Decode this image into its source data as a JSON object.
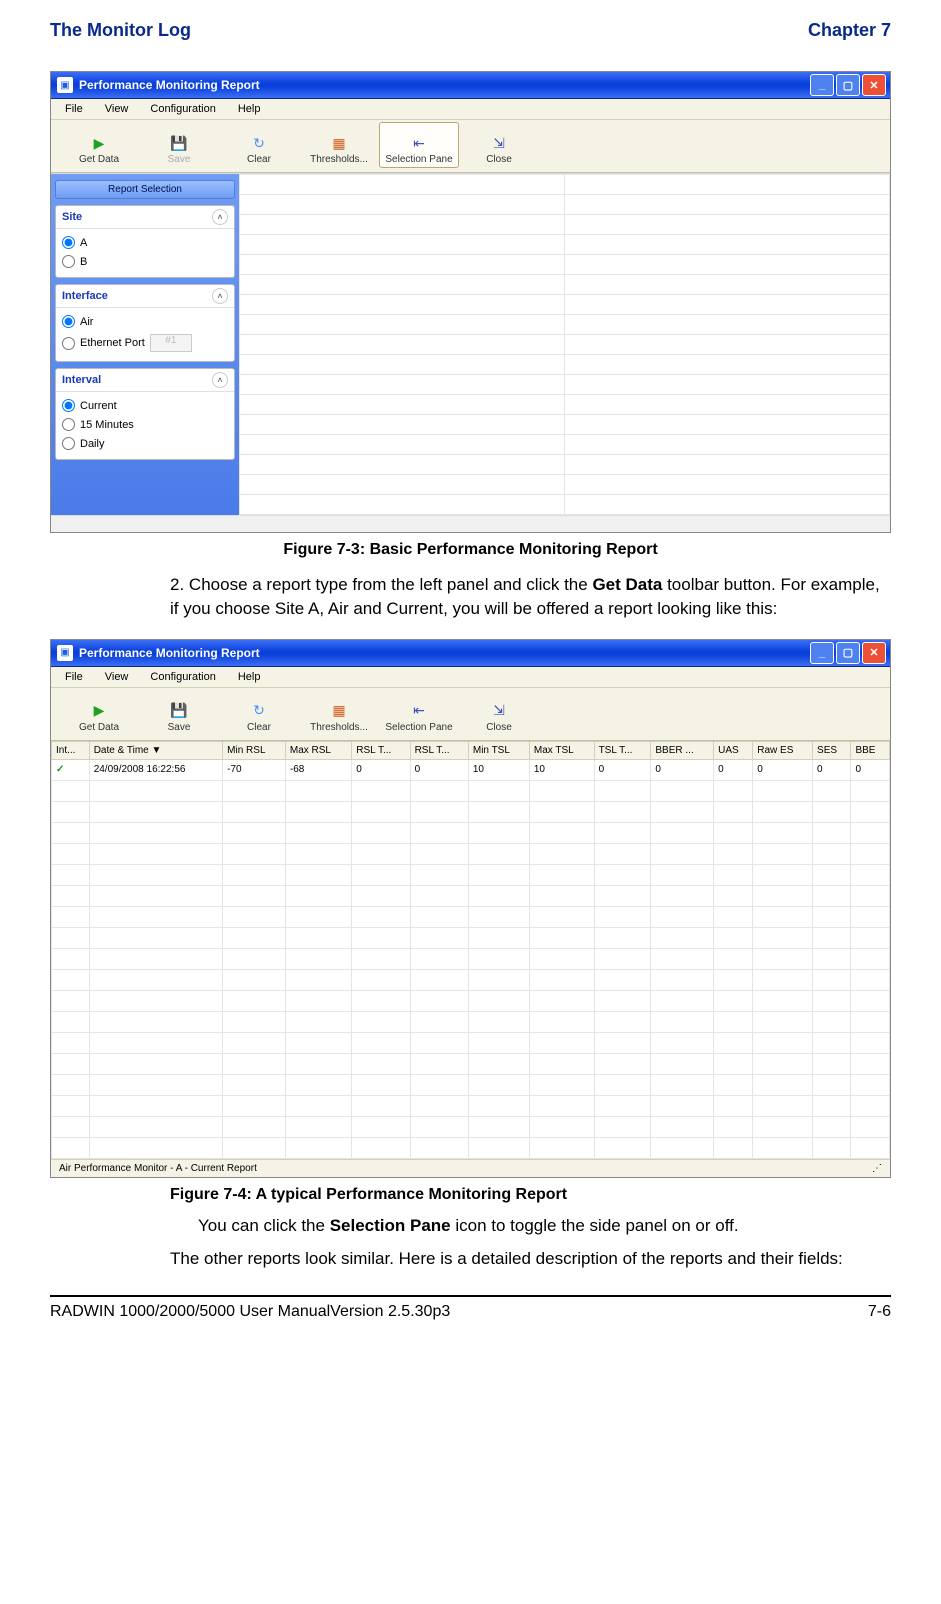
{
  "header": {
    "left": "The Monitor Log",
    "right": "Chapter 7"
  },
  "win1": {
    "title": "Performance Monitoring Report",
    "menus": [
      "File",
      "View",
      "Configuration",
      "Help"
    ],
    "toolbar": [
      {
        "label": "Get Data",
        "icon": "▶",
        "cls": "ic-play",
        "active": false
      },
      {
        "label": "Save",
        "icon": "💾",
        "cls": "ic-save",
        "active": false,
        "disabled": true
      },
      {
        "label": "Clear",
        "icon": "↻",
        "cls": "ic-clear",
        "active": false
      },
      {
        "label": "Thresholds...",
        "icon": "▦",
        "cls": "ic-thresh",
        "active": false
      },
      {
        "label": "Selection Pane",
        "icon": "⇤",
        "cls": "ic-sel",
        "active": true
      },
      {
        "label": "Close",
        "icon": "⇲",
        "cls": "ic-close",
        "active": false
      }
    ],
    "sidetab": "Report Selection",
    "panels": {
      "site": {
        "title": "Site",
        "options": [
          "A",
          "B"
        ],
        "selected": "A"
      },
      "iface": {
        "title": "Interface",
        "options": [
          "Air",
          "Ethernet Port"
        ],
        "selected": "Air",
        "spinner": "#1"
      },
      "interval": {
        "title": "Interval",
        "options": [
          "Current",
          "15 Minutes",
          "Daily"
        ],
        "selected": "Current"
      }
    }
  },
  "fig1_caption": "Figure 7-3: Basic Performance Monitoring Report",
  "step2": {
    "num": "2.",
    "text_a": "Choose a report type from the left panel and click the ",
    "bold": "Get Data",
    "text_b": " toolbar button. For example, if you choose Site A, Air and Current, you will be offered a report looking like this:"
  },
  "win2": {
    "title": "Performance Monitoring Report",
    "menus": [
      "File",
      "View",
      "Configuration",
      "Help"
    ],
    "toolbar": [
      {
        "label": "Get Data",
        "icon": "▶",
        "cls": "ic-play"
      },
      {
        "label": "Save",
        "icon": "💾",
        "cls": "ic-save"
      },
      {
        "label": "Clear",
        "icon": "↻",
        "cls": "ic-clear"
      },
      {
        "label": "Thresholds...",
        "icon": "▦",
        "cls": "ic-thresh"
      },
      {
        "label": "Selection Pane",
        "icon": "⇤",
        "cls": "ic-sel"
      },
      {
        "label": "Close",
        "icon": "⇲",
        "cls": "ic-close"
      }
    ],
    "columns": [
      "Int...",
      "Date & Time  ▼",
      "Min RSL",
      "Max RSL",
      "RSL T...",
      "RSL T...",
      "Min TSL",
      "Max TSL",
      "TSL T...",
      "BBER ...",
      "UAS",
      "Raw ES",
      "SES",
      "BBE"
    ],
    "row": {
      "int": "✓",
      "cells": [
        "24/09/2008 16:22:56",
        "-70",
        "-68",
        "0",
        "0",
        "10",
        "10",
        "0",
        "0",
        "0",
        "0",
        "0",
        "0"
      ]
    },
    "status": "Air Performance Monitor - A - Current Report"
  },
  "fig2_caption": "Figure 7-4: A typical Performance Monitoring Report",
  "tail": {
    "line1_a": "You can click the ",
    "line1_bold": "Selection Pane",
    "line1_b": " icon to toggle the side panel on or off.",
    "line2": "The other reports look similar. Here is a detailed description of the reports and their fields:"
  },
  "footer": {
    "left": "RADWIN 1000/2000/5000 User ManualVersion  2.5.30p3",
    "right": "7-6"
  }
}
